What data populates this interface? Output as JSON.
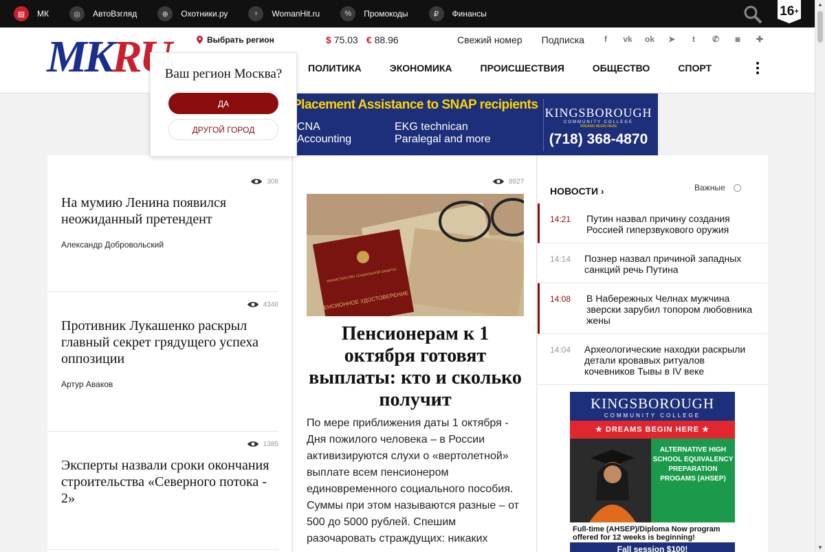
{
  "topbar": {
    "sites": [
      {
        "label": "МК",
        "icon": "document-icon"
      },
      {
        "label": "АвтоВзгляд",
        "icon": "steering-wheel-icon"
      },
      {
        "label": "Охотники.ру",
        "icon": "target-icon"
      },
      {
        "label": "WomanHit.ru",
        "icon": "female-symbol-icon"
      },
      {
        "label": "Промокоды",
        "icon": "percent-icon"
      },
      {
        "label": "Финансы",
        "icon": "ruble-icon"
      }
    ],
    "age_rating": "16",
    "age_suffix": "+"
  },
  "header": {
    "logo_mk": "MK",
    "logo_ru": "RU",
    "region_label": "Выбрать регион",
    "rates": [
      {
        "symbol": "$",
        "value": "75.03"
      },
      {
        "symbol": "€",
        "value": "88.96"
      }
    ],
    "links": [
      "Свежий номер",
      "Подписка"
    ],
    "socials": [
      "f",
      "vk",
      "ok",
      "tg",
      "tw",
      "vb",
      "ig",
      "+"
    ],
    "nav": [
      "ПОЛИТИКА",
      "ЭКОНОМИКА",
      "ПРОИСШЕСТВИЯ",
      "ОБЩЕСТВО",
      "СПОРТ"
    ]
  },
  "popup": {
    "question": "Ваш регион Москва?",
    "yes": "ДА",
    "other": "ДРУГОЙ ГОРОД"
  },
  "banner": {
    "headline": "Placement Assistance to SNAP recipients",
    "col1": [
      "CNA",
      "Accounting"
    ],
    "col2": [
      "EKG technican",
      "Paralegal and more"
    ],
    "brand": "KINGSBOROUGH",
    "brand_sub": "COMMUNITY COLLEGE",
    "brand_tag": "DREAMS BEGIN HERE",
    "phone": "(718) 368-4870"
  },
  "left_articles": [
    {
      "views": "308",
      "title": "На мумию Ленина появился неожиданный претендент",
      "author": "Александр Добровольский"
    },
    {
      "views": "4346",
      "title": "Противник Лукашенко раскрыл главный секрет грядущего успеха оппозиции",
      "author": "Артур Аваков"
    },
    {
      "views": "1385",
      "title": "Эксперты назвали сроки окончания строительства «Северного потока - 2»",
      "author": ""
    }
  ],
  "main_article": {
    "views": "8927",
    "title": "Пенсионерам к 1 октября готовят выплаты: кто и сколько получит",
    "text": "По мере приближения даты 1 октября - Дня пожилого человека – в России активизируются слухи о «вертолетной» выплате всем пенсионером единовременного социального пособия. Суммы при этом называются разные – от 500 до 5000 рублей. Спешим разочаровать страждущих: никаких",
    "photo_card_line1": "МИНИСТЕРСТВО СОЦИАЛЬНОЙ ЗАЩИТЫ",
    "photo_card_line2": "ПЕНСИОННОЕ УДОСТОВЕРЕНИЕ"
  },
  "news": {
    "heading": "НОВОСТИ",
    "important_label": "Важные",
    "items": [
      {
        "time": "14:21",
        "text": "Путин назвал причину создания Россией гиперзвукового оружия",
        "highlight": true
      },
      {
        "time": "14:14",
        "text": "Познер назвал причиной западных санкций речь Путина",
        "highlight": false
      },
      {
        "time": "14:08",
        "text": "В Набережных Челнах мужчина зверски зарубил топором любовника жены",
        "highlight": true
      },
      {
        "time": "14:04",
        "text": "Археологические находки раскрыли детали кровавых ритуалов кочевников Тывы в IV веке",
        "highlight": false
      }
    ]
  },
  "ad2": {
    "brand": "KINGSBOROUGH",
    "brand_sub": "COMMUNITY COLLEGE",
    "tag": "★ DREAMS BEGIN HERE ★",
    "program": "ALTERNATIVE HIGH SCHOOL EQUIVALENCY PREPARATION PROGAMS (AHSEP)",
    "fine": "Full-time (AHSEP)/Diploma Now program offered for 12 weeks is beginning!",
    "bottom": "Fall session $100!"
  },
  "colors": {
    "accent": "#8a0c0c",
    "brand_blue": "#1b2e8c",
    "brand_red": "#c8202f"
  }
}
